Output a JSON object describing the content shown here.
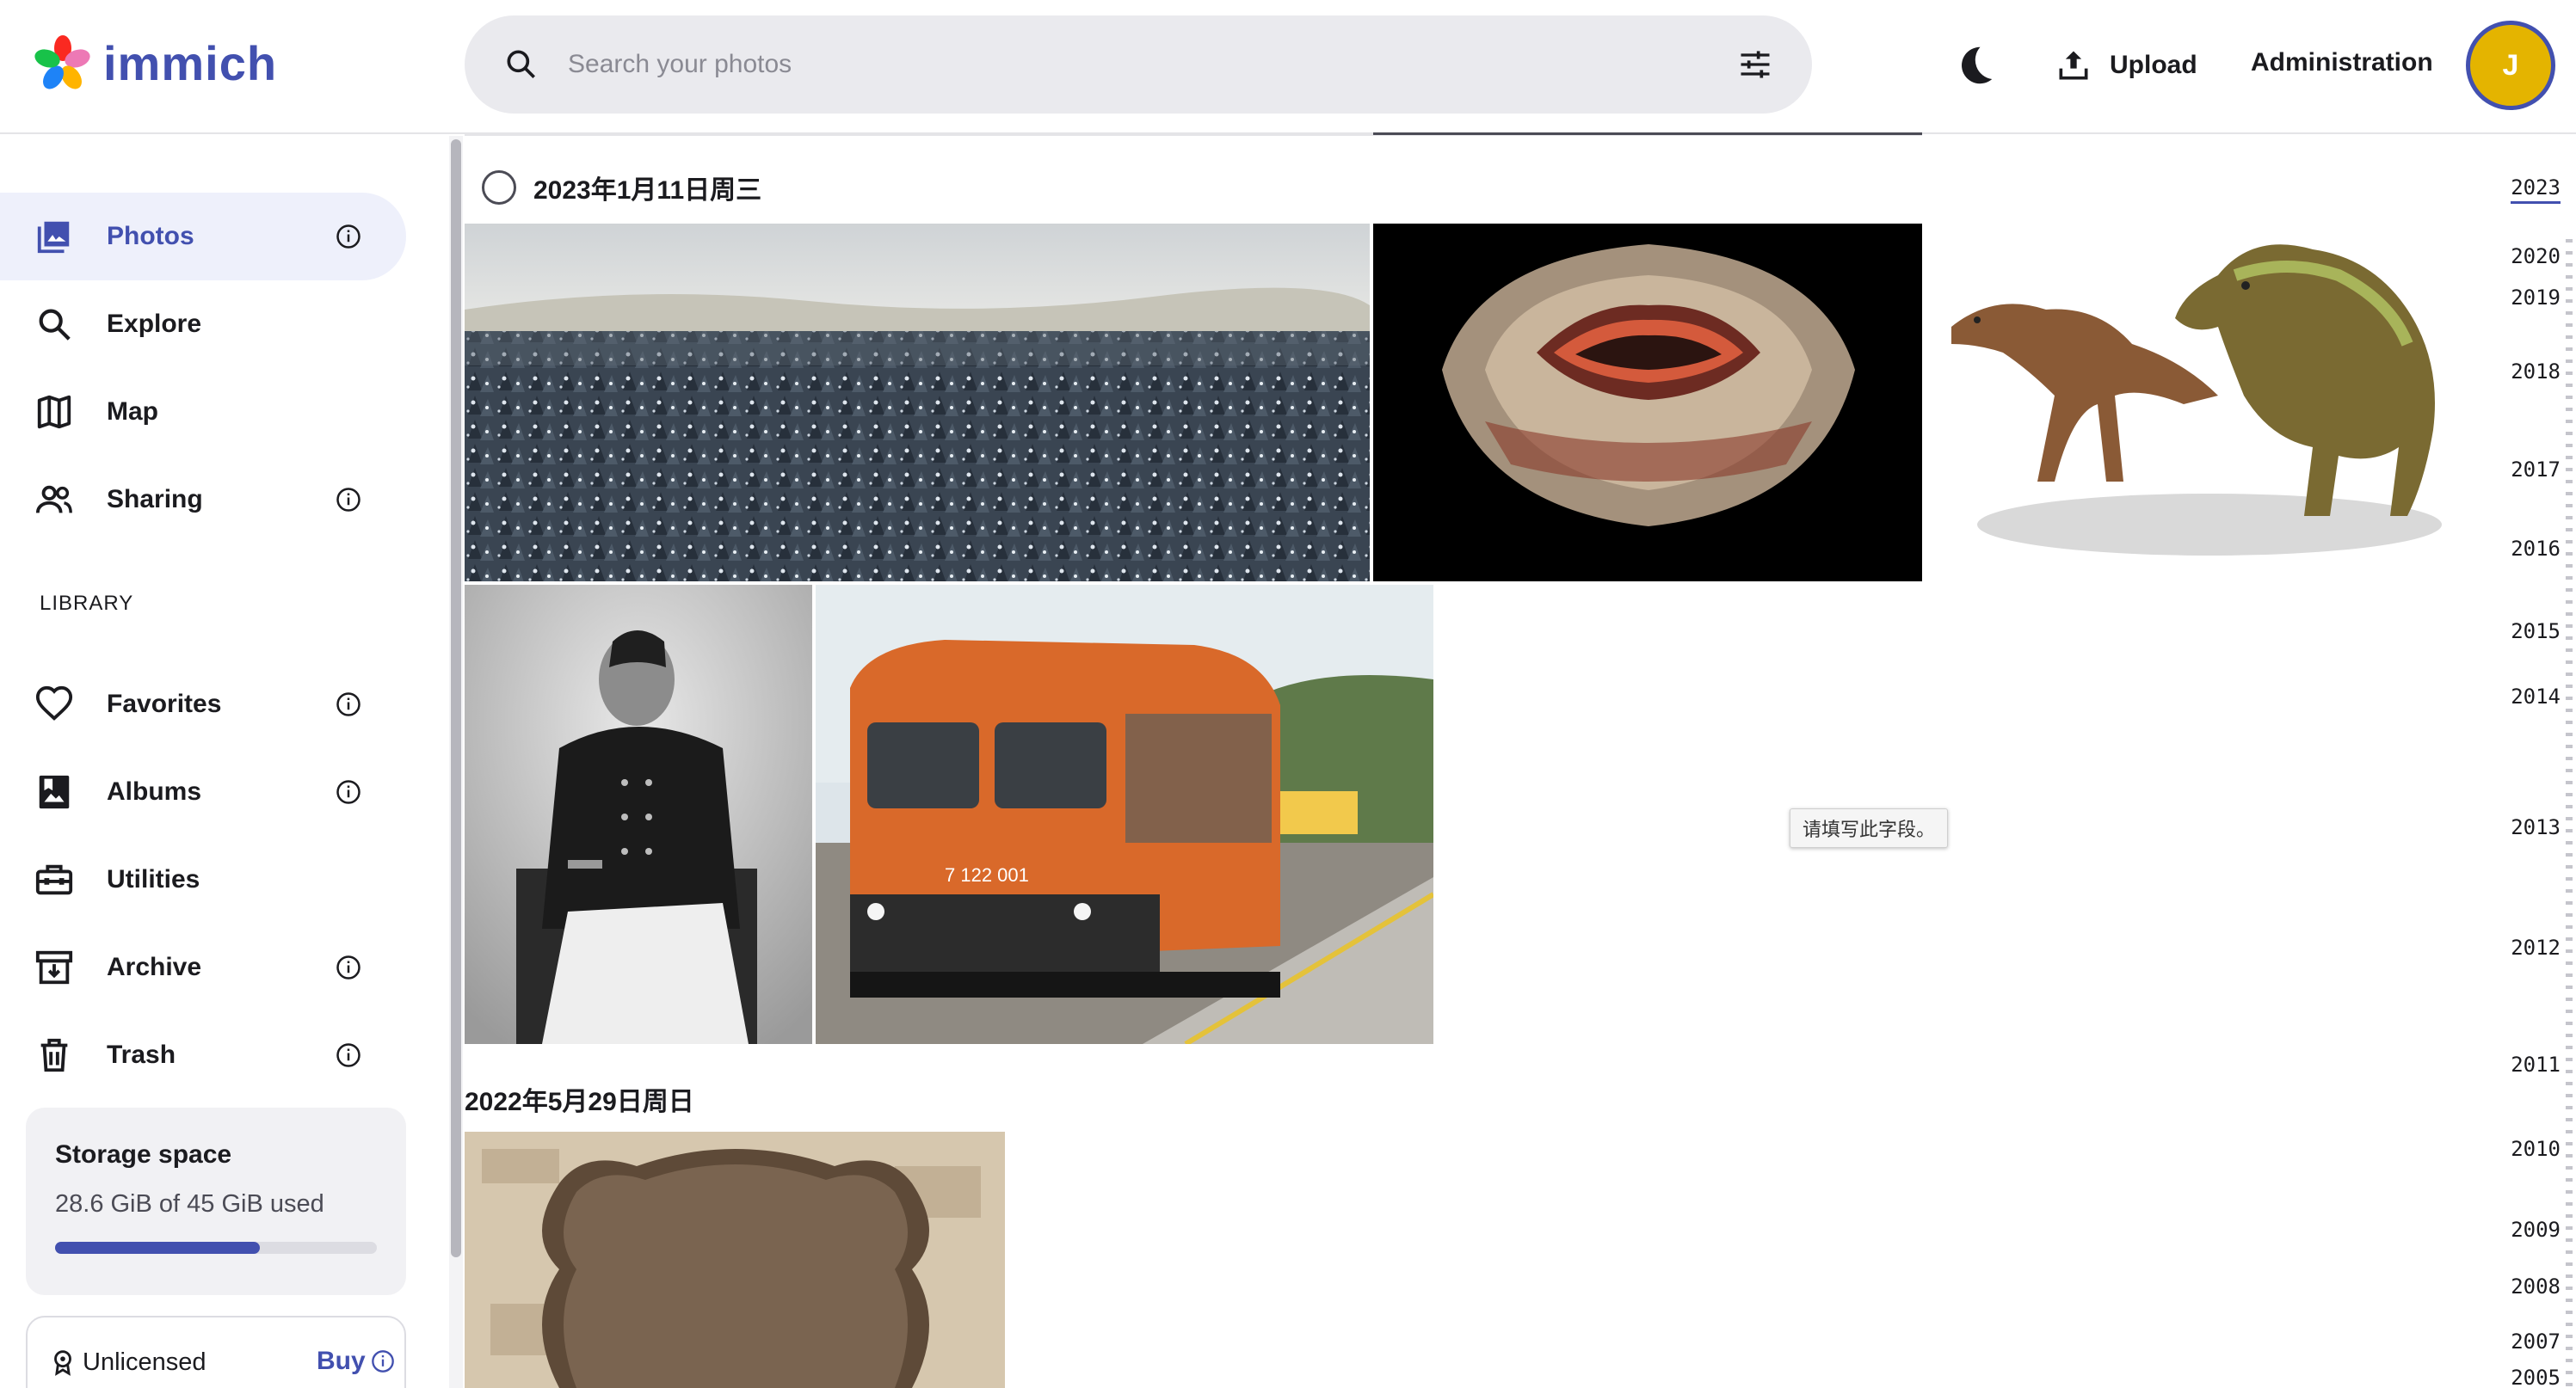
{
  "app": {
    "name": "immich"
  },
  "search": {
    "placeholder": "Search your photos"
  },
  "header": {
    "upload_label": "Upload",
    "admin_label": "Administration",
    "avatar_initial": "J"
  },
  "sidebar": {
    "items": [
      {
        "label": "Photos",
        "icon": "photos-icon",
        "active": true,
        "info": true
      },
      {
        "label": "Explore",
        "icon": "search-icon",
        "info": false
      },
      {
        "label": "Map",
        "icon": "map-icon",
        "info": false
      },
      {
        "label": "Sharing",
        "icon": "people-icon",
        "info": true
      }
    ],
    "library_label": "LIBRARY",
    "library_items": [
      {
        "label": "Favorites",
        "icon": "heart-icon",
        "info": true
      },
      {
        "label": "Albums",
        "icon": "album-icon",
        "info": true
      },
      {
        "label": "Utilities",
        "icon": "toolbox-icon",
        "info": false
      },
      {
        "label": "Archive",
        "icon": "archive-icon",
        "info": true
      },
      {
        "label": "Trash",
        "icon": "trash-icon",
        "info": true
      }
    ],
    "storage": {
      "title": "Storage space",
      "used_text": "28.6 GiB of 45 GiB used",
      "used_fraction": 0.636
    },
    "license": {
      "label": "Unlicensed",
      "buy_label": "Buy"
    }
  },
  "timeline": {
    "groups": [
      {
        "date": "2023年1月11日周三",
        "photos": [
          "snowy-forest",
          "agate-slice",
          "dinosaurs",
          "naval-officer-portrait",
          "orange-train"
        ]
      },
      {
        "date": "2022年5月29日周日",
        "photos": [
          "bronze-plaque"
        ]
      }
    ],
    "tooltip": "请填写此字段。"
  },
  "years": [
    "2023",
    "2020",
    "2019",
    "2018",
    "2017",
    "2016",
    "2015",
    "2014",
    "2013",
    "2012",
    "2011",
    "2010",
    "2009",
    "2008",
    "2007",
    "2005"
  ],
  "colors": {
    "accent": "#4250af",
    "avatar_bg": "#e4b400",
    "active_nav_bg": "#eef0fb"
  }
}
